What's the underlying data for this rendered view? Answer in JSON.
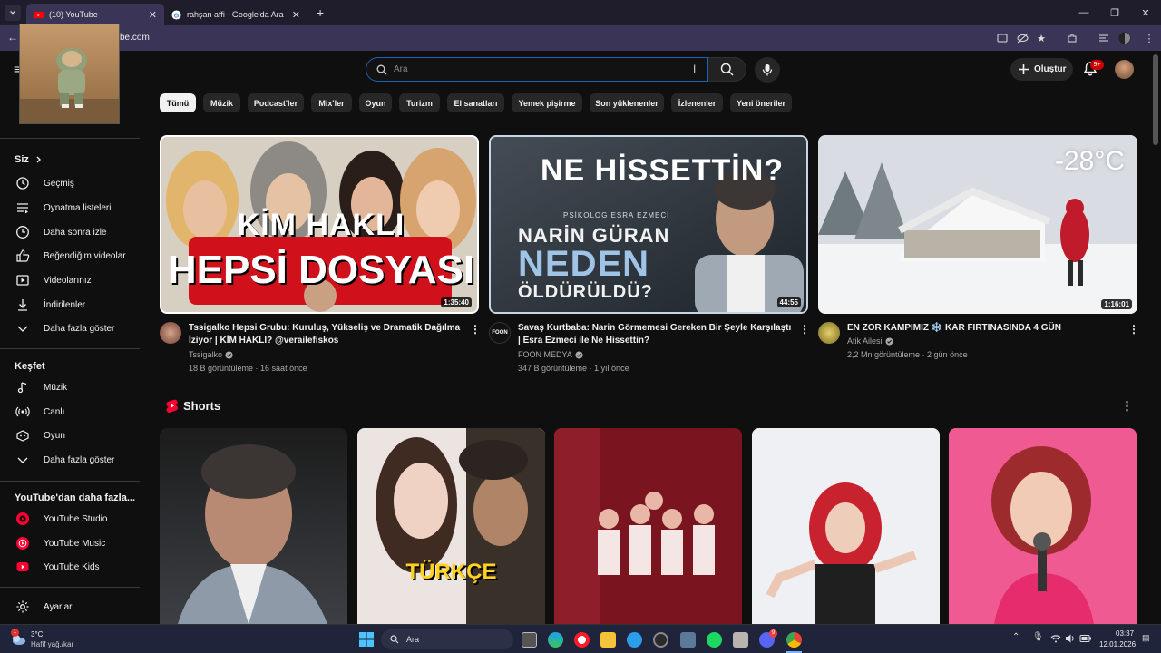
{
  "browser": {
    "tabs": [
      {
        "title": "(10) YouTube",
        "active": true
      },
      {
        "title": "rahşan affi - Google'da Ara",
        "active": false
      }
    ],
    "url": "be.com"
  },
  "header": {
    "search_placeholder": "Ara",
    "create_label": "Oluştur",
    "notifications_badge": "9+"
  },
  "chips": [
    "Tümü",
    "Müzik",
    "Podcast'ler",
    "Mix'ler",
    "Oyun",
    "Turizm",
    "El sanatları",
    "Yemek pişirme",
    "Son yüklenenler",
    "İzlenenler",
    "Yeni öneriler"
  ],
  "sidebar": {
    "you_header": "Siz",
    "you_items": [
      {
        "label": "Geçmiş",
        "icon": "history-icon"
      },
      {
        "label": "Oynatma listeleri",
        "icon": "playlists-icon"
      },
      {
        "label": "Daha sonra izle",
        "icon": "watch-later-icon"
      },
      {
        "label": "Beğendiğim videolar",
        "icon": "like-icon"
      },
      {
        "label": "Videolarınız",
        "icon": "your-videos-icon"
      },
      {
        "label": "İndirilenler",
        "icon": "download-icon"
      },
      {
        "label": "Daha fazla göster",
        "icon": "chevron-down-icon"
      }
    ],
    "explore_header": "Keşfet",
    "explore_items": [
      {
        "label": "Müzik",
        "icon": "music-icon"
      },
      {
        "label": "Canlı",
        "icon": "live-icon"
      },
      {
        "label": "Oyun",
        "icon": "gaming-icon"
      },
      {
        "label": "Daha fazla göster",
        "icon": "chevron-down-icon"
      }
    ],
    "more_header": "YouTube'dan daha fazla...",
    "more_items": [
      {
        "label": "YouTube Studio",
        "icon": "youtube-studio-icon"
      },
      {
        "label": "YouTube Music",
        "icon": "youtube-music-icon"
      },
      {
        "label": "YouTube Kids",
        "icon": "youtube-kids-icon"
      }
    ],
    "settings_label": "Ayarlar"
  },
  "videos": [
    {
      "thumb_text_1": "KİM HAKLI",
      "thumb_text_2": "HEPSİ DOSYASI",
      "duration": "1:35:40",
      "title": "Tssigalko Hepsi Grubu: Kuruluş, Yükseliş ve Dramatik Dağılma İziyor | KİM HAKLI? @verailefiskos",
      "channel": "Tssigalko",
      "meta": "18 B görüntüleme · 16 saat önce"
    },
    {
      "thumb_text_1": "NE HİSSETTİN?",
      "thumb_text_sub": "PSİKOLOG ESRA EZMECİ",
      "thumb_text_2": "NARİN GÜRAN",
      "thumb_text_3": "NEDEN",
      "thumb_text_4": "ÖLDÜRÜLDÜ?",
      "channel_logo": "FOON",
      "duration": "44:55",
      "title": "Savaş Kurtbaba: Narin Görmemesi Gereken Bir Şeyle Karşılaştı | Esra Ezmeci ile Ne Hissettin?",
      "channel": "FOON MEDYA",
      "meta": "347 B görüntüleme · 1 yıl önce"
    },
    {
      "thumb_text_1": "-28°C",
      "duration": "1:16:01",
      "title": "EN ZOR KAMPIMIZ ❄️ KAR FIRTINASINDA 4 GÜN",
      "channel": "Atik Ailesi",
      "meta": "2,2 Mn görüntüleme · 2 gün önce"
    }
  ],
  "shorts": {
    "title": "Shorts",
    "items": [
      {
        "overlay": ""
      },
      {
        "overlay": "TÜRKÇE"
      },
      {
        "overlay": ""
      },
      {
        "overlay": ""
      },
      {
        "overlay": ""
      }
    ]
  },
  "taskbar": {
    "weather_temp": "3°C",
    "weather_desc": "Hafif yağ./kar",
    "search_label": "Ara",
    "time": "03:37",
    "date": "12.01.2026",
    "discord_badge": "9"
  }
}
